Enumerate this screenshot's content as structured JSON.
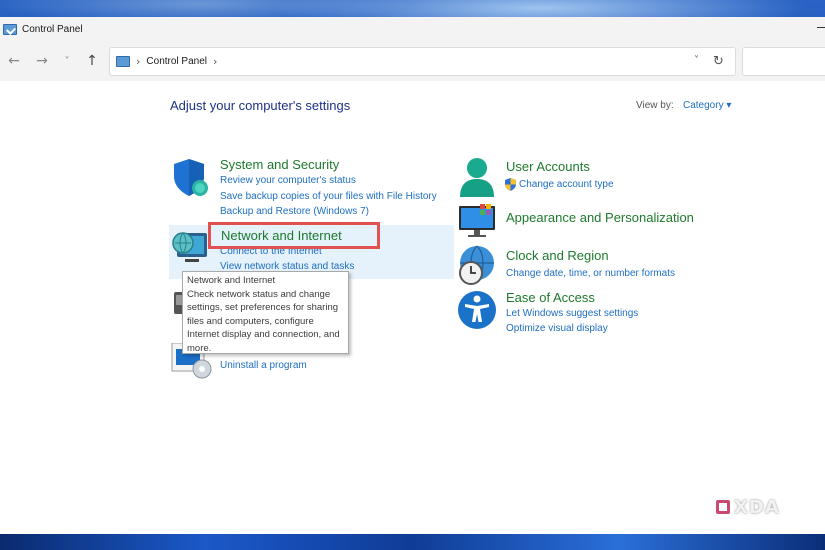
{
  "window": {
    "title": "Control Panel"
  },
  "nav": {
    "back": "←",
    "forward": "→",
    "recent": "˅",
    "up": "↑",
    "breadcrumb_sep": "›",
    "breadcrumb": "Control Panel",
    "breadcrumb_sep2": "›",
    "dropdown": "˅",
    "refresh": "↻"
  },
  "page": {
    "heading": "Adjust your computer's settings",
    "view_by_label": "View by:",
    "view_by_value": "Category ▾"
  },
  "categories": {
    "system": {
      "title": "System and Security",
      "links": [
        "Review your computer's status",
        "Save backup copies of your files with File History",
        "Backup and Restore (Windows 7)"
      ]
    },
    "network": {
      "title": "Network and Internet",
      "links": [
        "Connect to the Internet",
        "View network status and tasks"
      ]
    },
    "programs": {
      "links": [
        "Uninstall a program"
      ]
    },
    "users": {
      "title": "User Accounts",
      "links": [
        "Change account type"
      ]
    },
    "appearance": {
      "title": "Appearance and Personalization"
    },
    "clock": {
      "title": "Clock and Region",
      "links": [
        "Change date, time, or number formats"
      ]
    },
    "ease": {
      "title": "Ease of Access",
      "links": [
        "Let Windows suggest settings",
        "Optimize visual display"
      ]
    }
  },
  "tooltip": {
    "lines": [
      "Network and Internet",
      "Check network status and change",
      "settings, set preferences for sharing",
      "files and computers, configure",
      "Internet display and connection, and",
      "more."
    ]
  },
  "watermark": {
    "text": "XDA"
  },
  "colors": {
    "category_title": "#1d7a2d",
    "link": "#1e6fc2",
    "heading": "#1e3287",
    "highlight": "#e0524f"
  }
}
